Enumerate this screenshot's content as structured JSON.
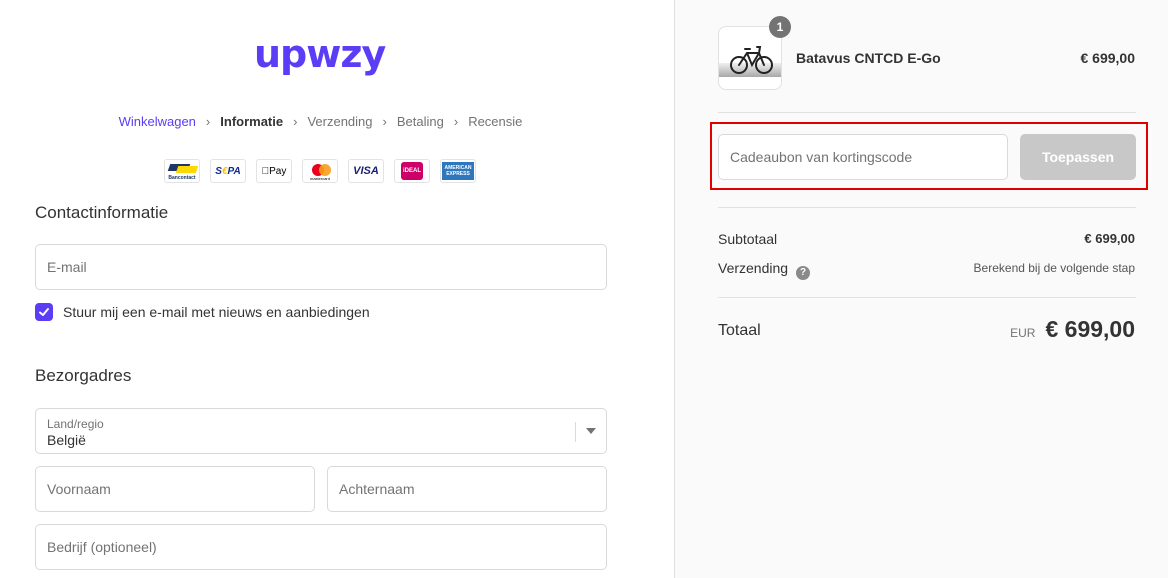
{
  "brand": {
    "logo_text": "upwzy",
    "accent": "#5a3df5"
  },
  "breadcrumb": [
    {
      "label": "Winkelwagen",
      "state": "link"
    },
    {
      "label": "Informatie",
      "state": "current"
    },
    {
      "label": "Verzending",
      "state": "future"
    },
    {
      "label": "Betaling",
      "state": "future"
    },
    {
      "label": "Recensie",
      "state": "future"
    }
  ],
  "payment_logos": {
    "bancontact": "Bancontact",
    "sepa_a": "S",
    "sepa_b": "€",
    "sepa_c": "PA",
    "applepay": "Pay",
    "mastercard": "mastercard",
    "visa": "VISA",
    "ideal": "iDEAL",
    "amex": "AMERICAN EXPRESS"
  },
  "contact": {
    "title": "Contactinformatie",
    "email_placeholder": "E-mail",
    "newsletter_label": "Stuur mij een e-mail met nieuws en aanbiedingen",
    "newsletter_checked": true
  },
  "shipping": {
    "title": "Bezorgadres",
    "country_label": "Land/regio",
    "country_value": "België",
    "firstname_placeholder": "Voornaam",
    "lastname_placeholder": "Achternaam",
    "company_placeholder": "Bedrijf (optioneel)"
  },
  "summary": {
    "product": {
      "name": "Batavus CNTCD E-Go",
      "price": "€ 699,00",
      "quantity": "1"
    },
    "discount_placeholder": "Cadeaubon van kortingscode",
    "apply_label": "Toepassen",
    "subtotal_label": "Subtotaal",
    "subtotal_value": "€ 699,00",
    "shipping_label": "Verzending",
    "shipping_help": "?",
    "shipping_value": "Berekend bij de volgende stap",
    "total_label": "Totaal",
    "currency": "EUR",
    "total_value": "€ 699,00"
  }
}
